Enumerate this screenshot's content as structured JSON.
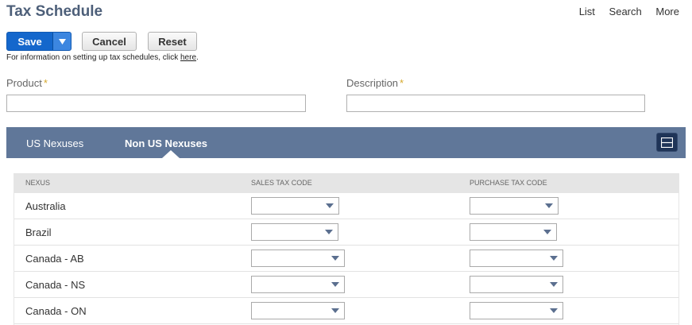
{
  "page": {
    "title": "Tax Schedule"
  },
  "top_links": [
    "List",
    "Search",
    "More"
  ],
  "toolbar": {
    "save_label": "Save",
    "cancel_label": "Cancel",
    "reset_label": "Reset"
  },
  "info": {
    "text": "For information on setting up tax schedules, click",
    "link": "here",
    "suffix": "."
  },
  "fields": {
    "product_label": "Product",
    "product_value": "",
    "description_label": "Description",
    "description_value": "",
    "required_mark": "*"
  },
  "tabs": [
    {
      "label": "US Nexuses",
      "active": false
    },
    {
      "label": "Non US Nexuses",
      "active": true
    }
  ],
  "grid": {
    "columns": [
      "NEXUS",
      "SALES TAX CODE",
      "PURCHASE TAX CODE"
    ],
    "rows": [
      {
        "nexus": "Australia",
        "sales_tax_code": "",
        "purchase_tax_code": ""
      },
      {
        "nexus": "Brazil",
        "sales_tax_code": "",
        "purchase_tax_code": ""
      },
      {
        "nexus": "Canada - AB",
        "sales_tax_code": "",
        "purchase_tax_code": ""
      },
      {
        "nexus": "Canada - NS",
        "sales_tax_code": "",
        "purchase_tax_code": ""
      },
      {
        "nexus": "Canada - ON",
        "sales_tax_code": "",
        "purchase_tax_code": ""
      }
    ]
  },
  "colors": {
    "title": "#4d5f79",
    "primary_button": "#1467cc",
    "tab_bar": "#607799",
    "required": "#d5a92e"
  }
}
